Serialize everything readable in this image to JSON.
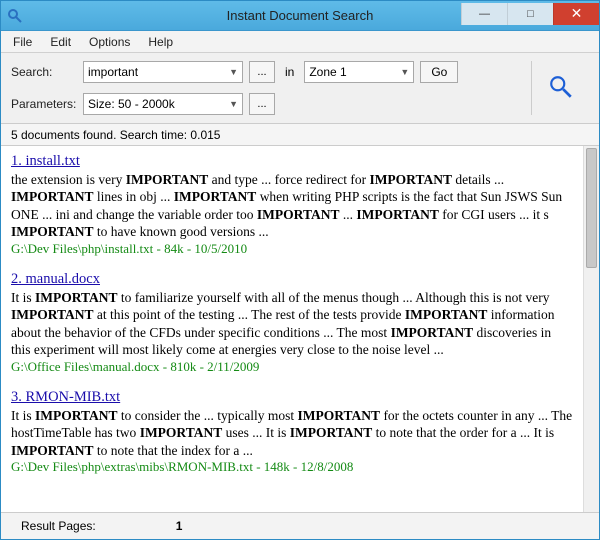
{
  "window": {
    "title": "Instant Document Search"
  },
  "menu": {
    "file": "File",
    "edit": "Edit",
    "options": "Options",
    "help": "Help"
  },
  "search": {
    "search_label": "Search:",
    "query": "important",
    "browse": "...",
    "in_label": "in",
    "zone": "Zone 1",
    "go": "Go",
    "params_label": "Parameters:",
    "params_value": "Size: 50 - 2000k",
    "params_browse": "..."
  },
  "status": {
    "text": "5 documents found. Search time: 0.015"
  },
  "results": [
    {
      "title": "1. install.txt",
      "snippet": "the extension is very <b>IMPORTANT</b> and type ... force redirect for <b>IMPORTANT</b> details ... <b>IMPORTANT</b> lines in obj ... <b>IMPORTANT</b> when writing PHP scripts is the fact that Sun JSWS Sun ONE ... ini and change the variable order too <b>IMPORTANT</b> ... <b>IMPORTANT</b> for CGI users ... it s <b>IMPORTANT</b> to have known good versions ...",
      "meta": "G:\\Dev Files\\php\\install.txt - 84k - 10/5/2010"
    },
    {
      "title": "2. manual.docx",
      "snippet": "It is <b>IMPORTANT</b> to familiarize yourself with all of the menus though ... Although this is not very <b>IMPORTANT</b> at this point of the testing ... The rest of the tests provide <b>IMPORTANT</b> information about the behavior of the CFDs under specific conditions ... The most <b>IMPORTANT</b> discoveries in this experiment will most likely come at energies very close to the noise level ...",
      "meta": "G:\\Office Files\\manual.docx - 810k - 2/11/2009"
    },
    {
      "title": "3. RMON-MIB.txt",
      "snippet": "It is <b>IMPORTANT</b> to consider the ... typically most <b>IMPORTANT</b> for the octets counter in any ... The hostTimeTable has two <b>IMPORTANT</b> uses ... It is <b>IMPORTANT</b> to note that the order for a ... It is <b>IMPORTANT</b> to note that the index for a ...",
      "meta": "G:\\Dev Files\\php\\extras\\mibs\\RMON-MIB.txt - 148k - 12/8/2008"
    }
  ],
  "footer": {
    "label": "Result Pages:",
    "page": "1"
  }
}
